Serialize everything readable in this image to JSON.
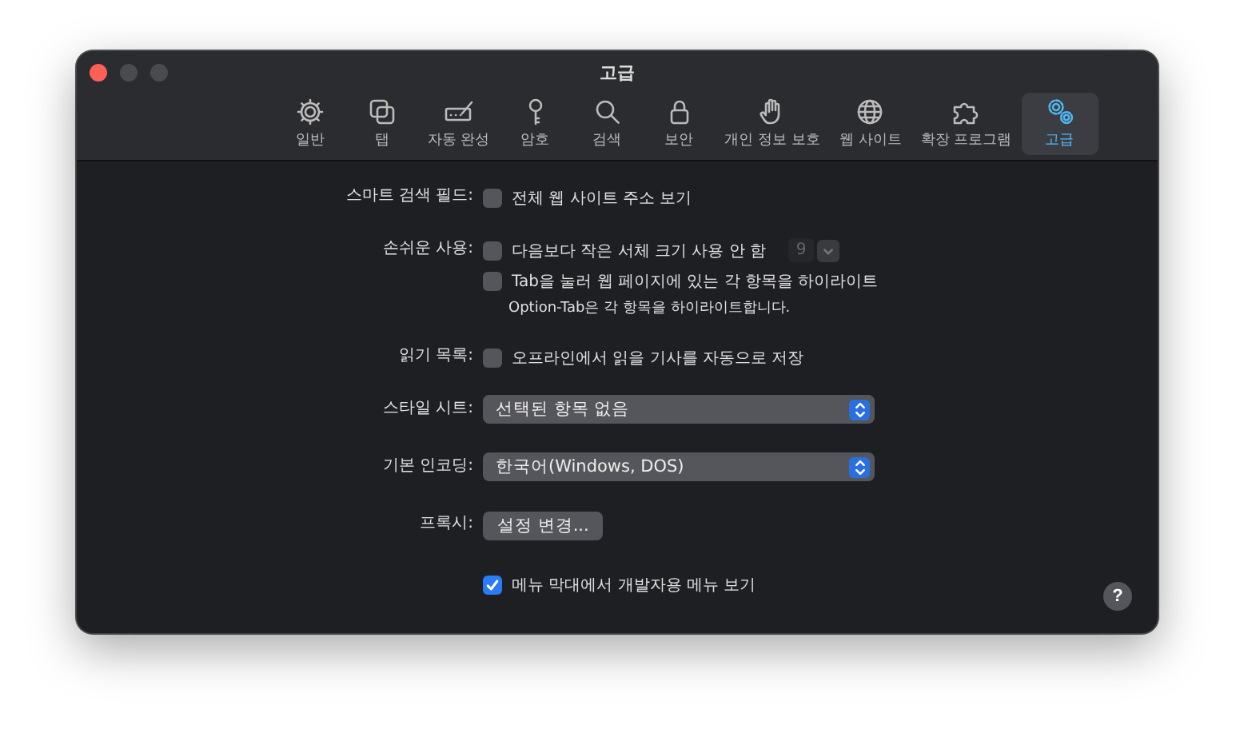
{
  "window": {
    "title": "고급"
  },
  "tabs": [
    {
      "label": "일반",
      "selected": false
    },
    {
      "label": "탭",
      "selected": false
    },
    {
      "label": "자동 완성",
      "selected": false
    },
    {
      "label": "암호",
      "selected": false
    },
    {
      "label": "검색",
      "selected": false
    },
    {
      "label": "보안",
      "selected": false
    },
    {
      "label": "개인 정보 보호",
      "selected": false
    },
    {
      "label": "웹 사이트",
      "selected": false
    },
    {
      "label": "확장 프로그램",
      "selected": false
    },
    {
      "label": "고급",
      "selected": true
    }
  ],
  "rows": [
    {
      "kind": "checks",
      "label": "스마트 검색 필드:",
      "items": [
        {
          "kind": "checkbox",
          "text": "전체 웹 사이트 주소 보기",
          "checked": false
        }
      ]
    },
    {
      "kind": "checks",
      "label": "손쉬운 사용:",
      "items": [
        {
          "kind": "checkbox",
          "text": "다음보다 작은 서체 크기 사용 안 함",
          "checked": false,
          "font_size": "9"
        },
        {
          "kind": "checkbox",
          "text": "Tab을 눌러 웹 페이지에 있는 각 항목을 하이라이트",
          "checked": false
        },
        {
          "kind": "note",
          "text": "Option-Tab은 각 항목을 하이라이트합니다."
        }
      ]
    },
    {
      "kind": "checks",
      "label": "읽기 목록:",
      "items": [
        {
          "kind": "checkbox",
          "text": "오프라인에서 읽을 기사를 자동으로 저장",
          "checked": false
        }
      ]
    },
    {
      "kind": "popup",
      "label": "스타일 시트:",
      "value": "선택된 항목 없음"
    },
    {
      "kind": "popup",
      "label": "기본 인코딩:",
      "value": "한국어(Windows, DOS)"
    },
    {
      "kind": "button",
      "label": "프록시:",
      "value": "설정 변경..."
    },
    {
      "kind": "checks",
      "items": [
        {
          "kind": "checkbox",
          "text": "메뉴 막대에서 개발자용 메뉴 보기",
          "checked": true
        }
      ]
    }
  ],
  "help": "?"
}
